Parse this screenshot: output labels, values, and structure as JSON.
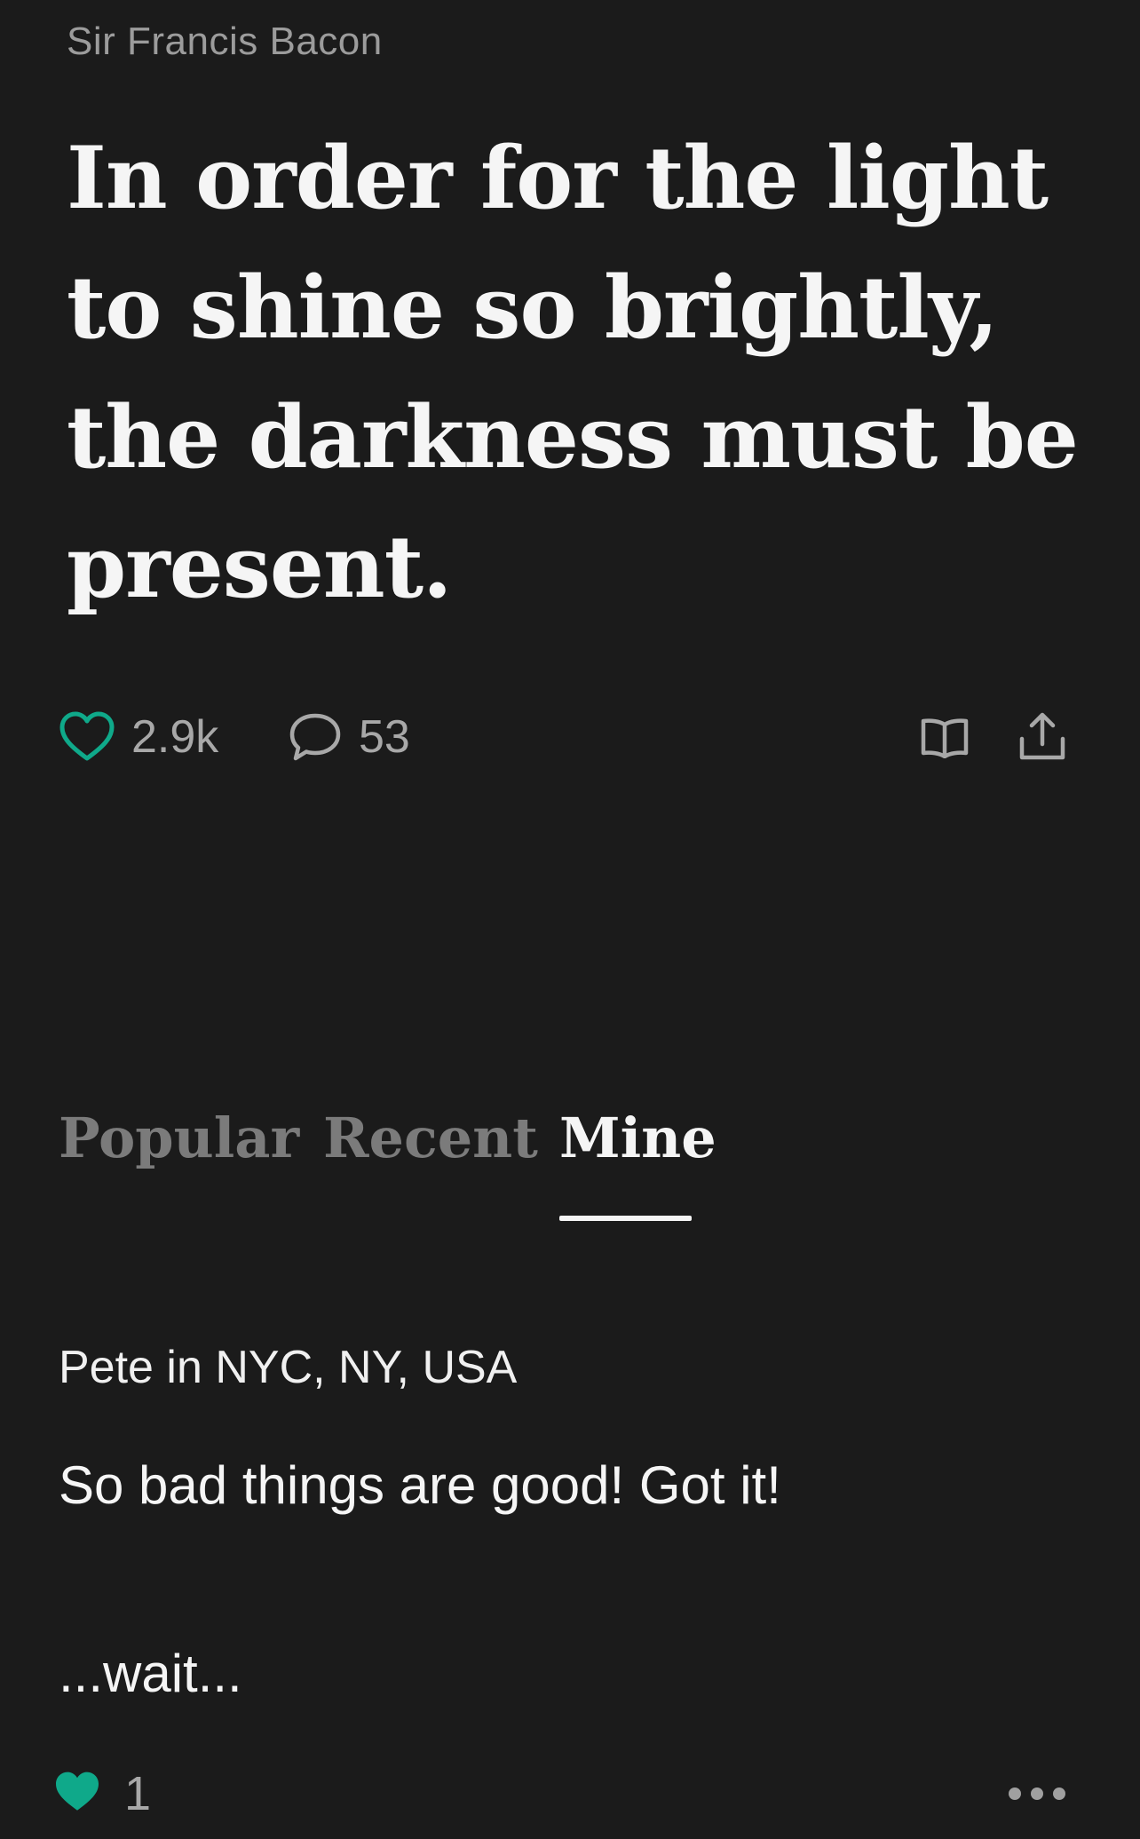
{
  "quote": {
    "author": "Sir Francis Bacon",
    "text": "In order for the light to shine so brightly, the darkness must be present."
  },
  "actions": {
    "likes": "2.9k",
    "comments": "53"
  },
  "tabs": [
    {
      "label": "Popular",
      "active": false
    },
    {
      "label": "Recent",
      "active": false
    },
    {
      "label": "Mine",
      "active": true
    }
  ],
  "comment": {
    "author": "Pete in NYC, NY, USA",
    "lines": [
      "So bad things are good! Got it!",
      "...wait..."
    ],
    "likes": "1"
  },
  "colors": {
    "accent": "#0fa98a",
    "background": "#1b1b1b",
    "muted": "#a8a8a8"
  }
}
